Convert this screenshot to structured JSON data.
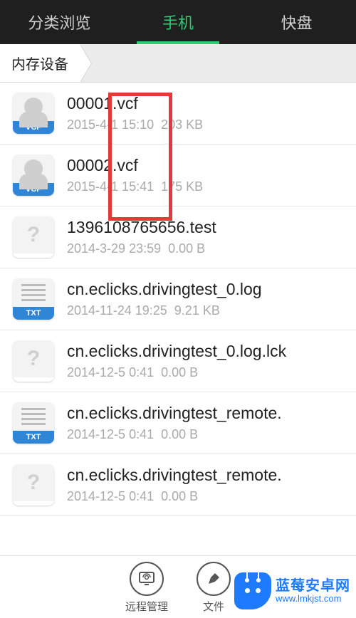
{
  "tabs": [
    {
      "label": "分类浏览",
      "active": false
    },
    {
      "label": "手机",
      "active": true
    },
    {
      "label": "快盘",
      "active": false
    }
  ],
  "breadcrumb": {
    "root": "内存设备"
  },
  "files": [
    {
      "name": "00001.vcf",
      "date": "2015-4-1 15:10",
      "size": "203 KB",
      "type": "vcf",
      "badge": "VCF"
    },
    {
      "name": "00002.vcf",
      "date": "2015-4-1 15:41",
      "size": "175 KB",
      "type": "vcf",
      "badge": "VCF"
    },
    {
      "name": "1396108765656.test",
      "date": "2014-3-29 23:59",
      "size": "0.00 B",
      "type": "unknown",
      "badge": ""
    },
    {
      "name": "cn.eclicks.drivingtest_0.log",
      "date": "2014-11-24 19:25",
      "size": "9.21 KB",
      "type": "txt",
      "badge": "TXT"
    },
    {
      "name": "cn.eclicks.drivingtest_0.log.lck",
      "date": "2014-12-5 0:41",
      "size": "0.00 B",
      "type": "unknown",
      "badge": ""
    },
    {
      "name": "cn.eclicks.drivingtest_remote.",
      "date": "2014-12-5 0:41",
      "size": "0.00 B",
      "type": "txt",
      "badge": "TXT"
    },
    {
      "name": "cn.eclicks.drivingtest_remote.",
      "date": "2014-12-5 0:41",
      "size": "0.00 B",
      "type": "unknown",
      "badge": ""
    }
  ],
  "bottom": {
    "remote": {
      "label": "远程管理",
      "glyph": "⌂"
    },
    "file": {
      "label": "文件",
      "glyph": "✎"
    }
  },
  "watermark": {
    "title": "蓝莓安卓网",
    "sub": "www.lmkjst.com"
  }
}
